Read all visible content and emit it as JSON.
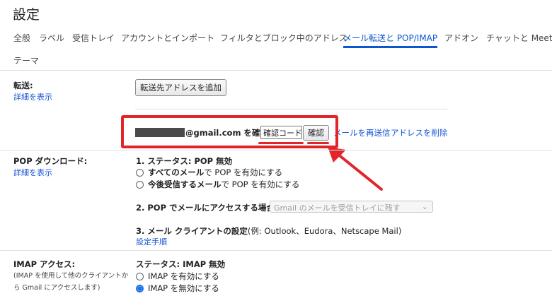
{
  "page": {
    "title": "設定"
  },
  "tabs": [
    {
      "label": "全般"
    },
    {
      "label": "ラベル"
    },
    {
      "label": "受信トレイ"
    },
    {
      "label": "アカウントとインポート"
    },
    {
      "label": "フィルタとブロック中のアドレス"
    },
    {
      "label": "メール転送と POP/IMAP",
      "active": true
    },
    {
      "label": "アドオン"
    },
    {
      "label": "チャットと Meet"
    },
    {
      "label": "テーマ"
    }
  ],
  "forwarding": {
    "label": "転送:",
    "details_link": "詳細を表示",
    "add_button": "転送先アドレスを追加",
    "email_suffix": "@gmail.com を確認",
    "code_placeholder": "確認コード",
    "confirm_button": "確認",
    "resend_link": "メールを再送信",
    "delete_link": "アドレスを削除"
  },
  "pop": {
    "label": "POP ダウンロード:",
    "details_link": "詳細を表示",
    "status_heading": "1. ステータス: POP 無効",
    "option1_bold": "すべてのメール",
    "option1_rest": "で POP を有効にする",
    "option2_bold": "今後受信するメール",
    "option2_rest": "で POP を有効にする",
    "section2_heading": "2. POP でメールにアクセスする場合",
    "section2_select": "Gmail のメールを受信トレイに残す",
    "section3_heading": "3. メール クライアントの設定",
    "section3_note": "(例: Outlook、Eudora、Netscape Mail)",
    "setup_link": "設定手順"
  },
  "imap": {
    "label": "IMAP アクセス:",
    "desc_line1": "(IMAP を使用して他のクライアントか",
    "desc_line2": "ら Gmail にアクセスします)",
    "status_heading": "ステータス: IMAP 無効",
    "option_enable": "IMAP を有効にする",
    "option_disable": "IMAP を無効にする",
    "selected": "disable"
  },
  "annotation": {
    "highlight_color": "#e0262b"
  }
}
